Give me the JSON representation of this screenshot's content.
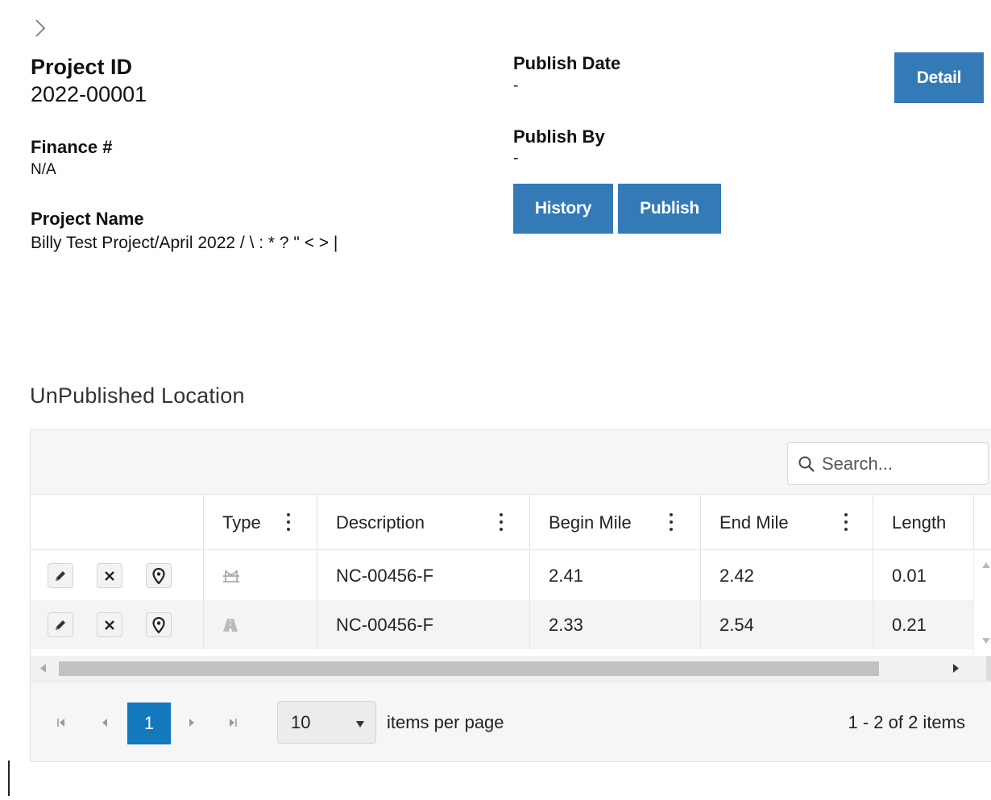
{
  "project": {
    "id_label": "Project ID",
    "id_value": "2022-00001",
    "finance_label": "Finance #",
    "finance_value": "N/A",
    "name_label": "Project Name",
    "name_value": "Billy Test Project/April 2022 / \\ : * ? \" < > |"
  },
  "publish": {
    "date_label": "Publish Date",
    "date_value": "-",
    "by_label": "Publish By",
    "by_value": "-"
  },
  "buttons": {
    "detail": "Detail",
    "history": "History",
    "publish": "Publish"
  },
  "section": {
    "title": "UnPublished Location"
  },
  "grid": {
    "search_placeholder": "Search...",
    "columns": [
      "Type",
      "Description",
      "Begin Mile",
      "End Mile",
      "Length"
    ],
    "rows": [
      {
        "type_icon": "bridge-icon",
        "description": "NC-00456-F",
        "begin_mile": "2.41",
        "end_mile": "2.42",
        "length": "0.01"
      },
      {
        "type_icon": "road-icon",
        "description": "NC-00456-F",
        "begin_mile": "2.33",
        "end_mile": "2.54",
        "length": "0.21"
      }
    ],
    "row_actions": [
      "edit-icon",
      "delete-icon",
      "map-pin-icon"
    ]
  },
  "pager": {
    "current_page": "1",
    "page_size": "10",
    "page_size_label": "items per page",
    "info": "1 - 2 of 2 items"
  },
  "colors": {
    "primary_button": "#337ab7",
    "pager_active": "#1478bd",
    "toolbar_bg": "#f6f6f6",
    "alt_row_bg": "#f4f4f4"
  }
}
